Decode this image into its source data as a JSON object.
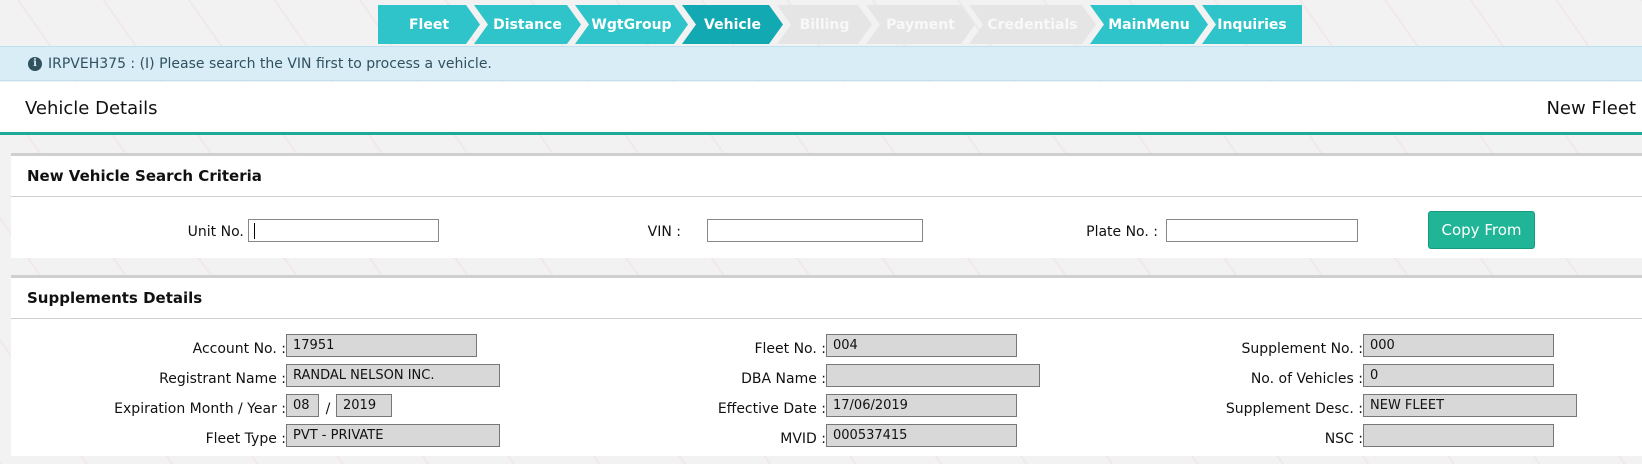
{
  "wizard": {
    "steps": [
      {
        "label": "Fleet",
        "state": "done"
      },
      {
        "label": "Distance",
        "state": "done"
      },
      {
        "label": "WgtGroup",
        "state": "done"
      },
      {
        "label": "Vehicle",
        "state": "active"
      },
      {
        "label": "Billing",
        "state": "disabled"
      },
      {
        "label": "Payment",
        "state": "disabled"
      },
      {
        "label": "Credentials",
        "state": "disabled"
      },
      {
        "label": "MainMenu",
        "state": "done"
      },
      {
        "label": "Inquiries",
        "state": "done"
      }
    ]
  },
  "info": {
    "icon": "info-circle-icon",
    "message": "IRPVEH375 : (I) Please search the VIN first to process a vehicle."
  },
  "header": {
    "title": "Vehicle Details",
    "right_label": "New Fleet"
  },
  "search": {
    "title": "New Vehicle Search Criteria",
    "unit_label": "Unit No. :",
    "unit_value": "",
    "vin_label": "VIN :",
    "vin_value": "",
    "plate_label": "Plate No. :",
    "plate_value": "",
    "copy_button": "Copy From"
  },
  "supplements": {
    "title": "Supplements Details",
    "account_label": "Account No. :",
    "account_value": "17951",
    "registrant_label": "Registrant Name :",
    "registrant_value": "RANDAL NELSON INC.",
    "expiration_label": "Expiration Month / Year :",
    "expiration_month": "08",
    "expiration_sep": "/",
    "expiration_year": "2019",
    "fleet_type_label": "Fleet Type :",
    "fleet_type_value": "PVT - PRIVATE",
    "fleet_no_label": "Fleet No. :",
    "fleet_no_value": "004",
    "dba_label": "DBA Name :",
    "dba_value": "",
    "effective_label": "Effective Date :",
    "effective_value": "17/06/2019",
    "mvid_label": "MVID :",
    "mvid_value": "000537415",
    "supplement_no_label": "Supplement No. :",
    "supplement_no_value": "000",
    "num_vehicles_label": "No. of Vehicles :",
    "num_vehicles_value": "0",
    "supplement_desc_label": "Supplement Desc. :",
    "supplement_desc_value": "NEW FLEET",
    "nsc_label": "NSC :",
    "nsc_value": ""
  },
  "colors": {
    "step_done": "#2ec4c9",
    "step_active": "#12a9b3",
    "step_disabled": "#e5e5e5",
    "accent": "#21a997",
    "button": "#1fb596",
    "info_bg": "#d9edf7"
  }
}
